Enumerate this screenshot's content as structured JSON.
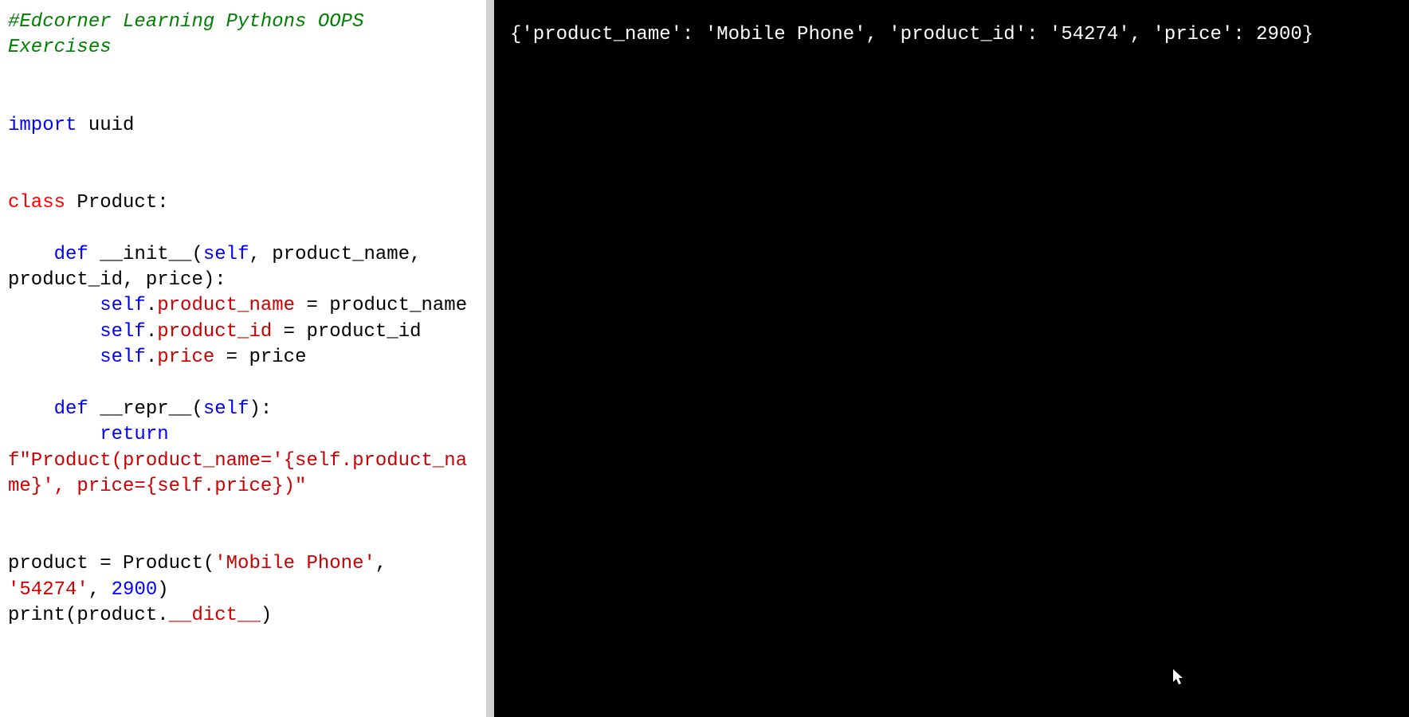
{
  "editor": {
    "comment": "#Edcorner Learning Pythons OOPS Exercises",
    "import_kw": "import",
    "import_module": " uuid",
    "class_kw": "class",
    "class_name": " Product:",
    "def_kw": "def",
    "init_name": " __init__(",
    "self_kw": "self",
    "init_params": ", product_name, product_id, price):",
    "attr_product_name": "product_name",
    "assign_product_name": " = product_name",
    "attr_product_id": "product_id",
    "assign_product_id": " = product_id",
    "attr_price": "price",
    "assign_price": " = price",
    "repr_name": " __repr__(",
    "repr_close": "):",
    "return_kw": "return",
    "fstring_open": "f\"Product(product_name='",
    "fstring_mid1": "{self.product_name}",
    "fstring_mid2": "', price=",
    "fstring_mid3": "{self.price}",
    "fstring_close": ")\"",
    "product_var": "product = Product(",
    "str_mobile": "'Mobile Phone'",
    "comma1": ", ",
    "str_id": "'54274'",
    "comma2": ", ",
    "num_price": "2900",
    "close_paren": ")",
    "print_open": "print(product.",
    "dict_attr": "__dict__",
    "print_close": ")",
    "dot": ".",
    "indent4": "    ",
    "indent8": "        "
  },
  "output": {
    "line1": "{'product_name': 'Mobile Phone', 'product_id': '54274', 'price': 2900}"
  }
}
